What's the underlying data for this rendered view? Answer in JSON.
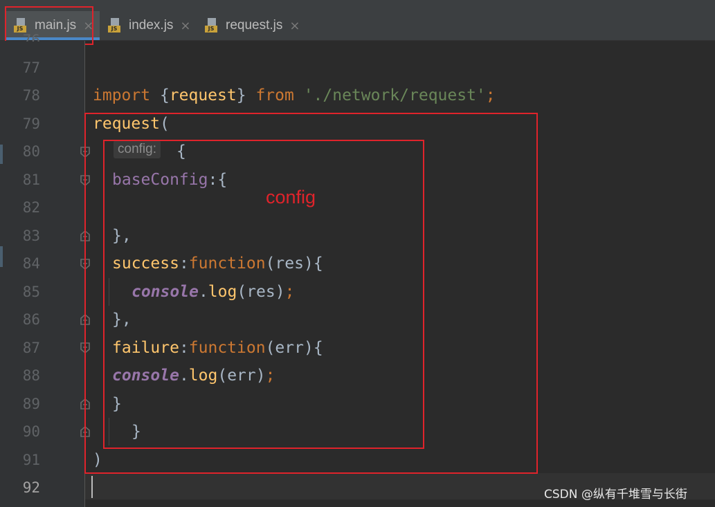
{
  "tabs": [
    {
      "label": "main.js",
      "active": true,
      "icon": "js-file-icon"
    },
    {
      "label": "index.js",
      "active": false,
      "icon": "js-file-icon"
    },
    {
      "label": "request.js",
      "active": false,
      "icon": "js-file-icon"
    }
  ],
  "icon_badge": "JS",
  "close_glyph": "×",
  "partial_top_line": {
    "number": "76",
    "text": "//  })"
  },
  "line_numbers": [
    "77",
    "78",
    "79",
    "80",
    "81",
    "82",
    "83",
    "84",
    "85",
    "86",
    "87",
    "88",
    "89",
    "90",
    "91",
    "92"
  ],
  "code": {
    "l78": {
      "import": "import",
      "open": " {",
      "name": "request",
      "close": "} ",
      "from": "from",
      "space": " ",
      "path": "'./network/request'",
      "semi": ";"
    },
    "l79": {
      "call": "request",
      "paren": "("
    },
    "l80": {
      "hint": "config:",
      "brace": "{"
    },
    "l81": {
      "key": "baseConfig",
      "rest": ":{"
    },
    "l83": {
      "text": "},"
    },
    "l84": {
      "key": "success",
      "colon": ":",
      "kw": "function",
      "args": "(res){"
    },
    "l85": {
      "obj": "console",
      "dot": ".",
      "method": "log",
      "args": "(res)",
      "semi": ";"
    },
    "l86": {
      "text": "},"
    },
    "l87": {
      "key": "failure",
      "colon": ":",
      "kw": "function",
      "args": "(err){"
    },
    "l88": {
      "obj": "console",
      "dot": ".",
      "method": "log",
      "args": "(err)",
      "semi": ";"
    },
    "l89": {
      "text": "}"
    },
    "l90": {
      "text": "}"
    },
    "l91": {
      "text": ")"
    }
  },
  "annotation": "config",
  "watermark": "CSDN @纵有千堆雪与长街",
  "colors": {
    "annotation_red": "#e0232b",
    "keyword": "#cc7832",
    "string": "#6a8759",
    "function": "#ffc66d",
    "property": "#9876aa",
    "plain": "#a9b7c6"
  }
}
